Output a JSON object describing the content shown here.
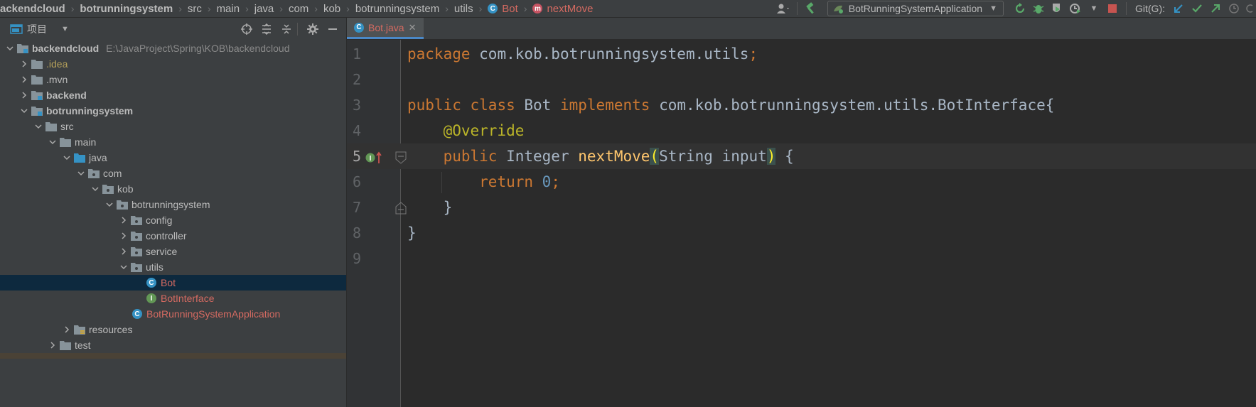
{
  "breadcrumbs": [
    "ackendcloud",
    "botrunningsystem",
    "src",
    "main",
    "java",
    "com",
    "kob",
    "botrunningsystem",
    "utils",
    "Bot",
    "nextMove"
  ],
  "toolbar": {
    "run_config": "BotRunningSystemApplication",
    "git_label": "Git(G):"
  },
  "project_panel": {
    "title": "项目",
    "tree": [
      {
        "label": "backendcloud",
        "path": "E:\\JavaProject\\Spring\\KOB\\backendcloud"
      },
      {
        "label": ".idea"
      },
      {
        "label": ".mvn"
      },
      {
        "label": "backend"
      },
      {
        "label": "botrunningsystem"
      },
      {
        "label": "src"
      },
      {
        "label": "main"
      },
      {
        "label": "java"
      },
      {
        "label": "com"
      },
      {
        "label": "kob"
      },
      {
        "label": "botrunningsystem"
      },
      {
        "label": "config"
      },
      {
        "label": "controller"
      },
      {
        "label": "service"
      },
      {
        "label": "utils"
      },
      {
        "label": "Bot"
      },
      {
        "label": "BotInterface"
      },
      {
        "label": "BotRunningSystemApplication"
      },
      {
        "label": "resources"
      },
      {
        "label": "test"
      }
    ]
  },
  "editor": {
    "tab_label": "Bot.java",
    "line_numbers": [
      "1",
      "2",
      "3",
      "4",
      "5",
      "6",
      "7",
      "8",
      "9"
    ],
    "code": {
      "l1_kw": "package",
      "l1_rest": " com.kob.botrunningsystem.utils",
      "l1_semi": ";",
      "l3_kw1": "public",
      "l3_kw2": "class",
      "l3_name": "Bot",
      "l3_kw3": "implements",
      "l3_rest": "com.kob.botrunningsystem.utils.BotInterface{",
      "l4_ann": "@Override",
      "l5_kw": "public",
      "l5_type": "Integer",
      "l5_fn": "nextMove",
      "l5_open": "(",
      "l5_params": "String input",
      "l5_close": ")",
      "l5_brace": " {",
      "l6_kw": "return",
      "l6_num": "0",
      "l6_semi": ";",
      "l7": "}",
      "l8": "}"
    }
  },
  "colors": {
    "keyword": "#cc7832",
    "annotation": "#bbb529",
    "function": "#ffc66d",
    "number": "#6897bb",
    "error_file": "#d46a61",
    "selection": "#0d293e"
  }
}
